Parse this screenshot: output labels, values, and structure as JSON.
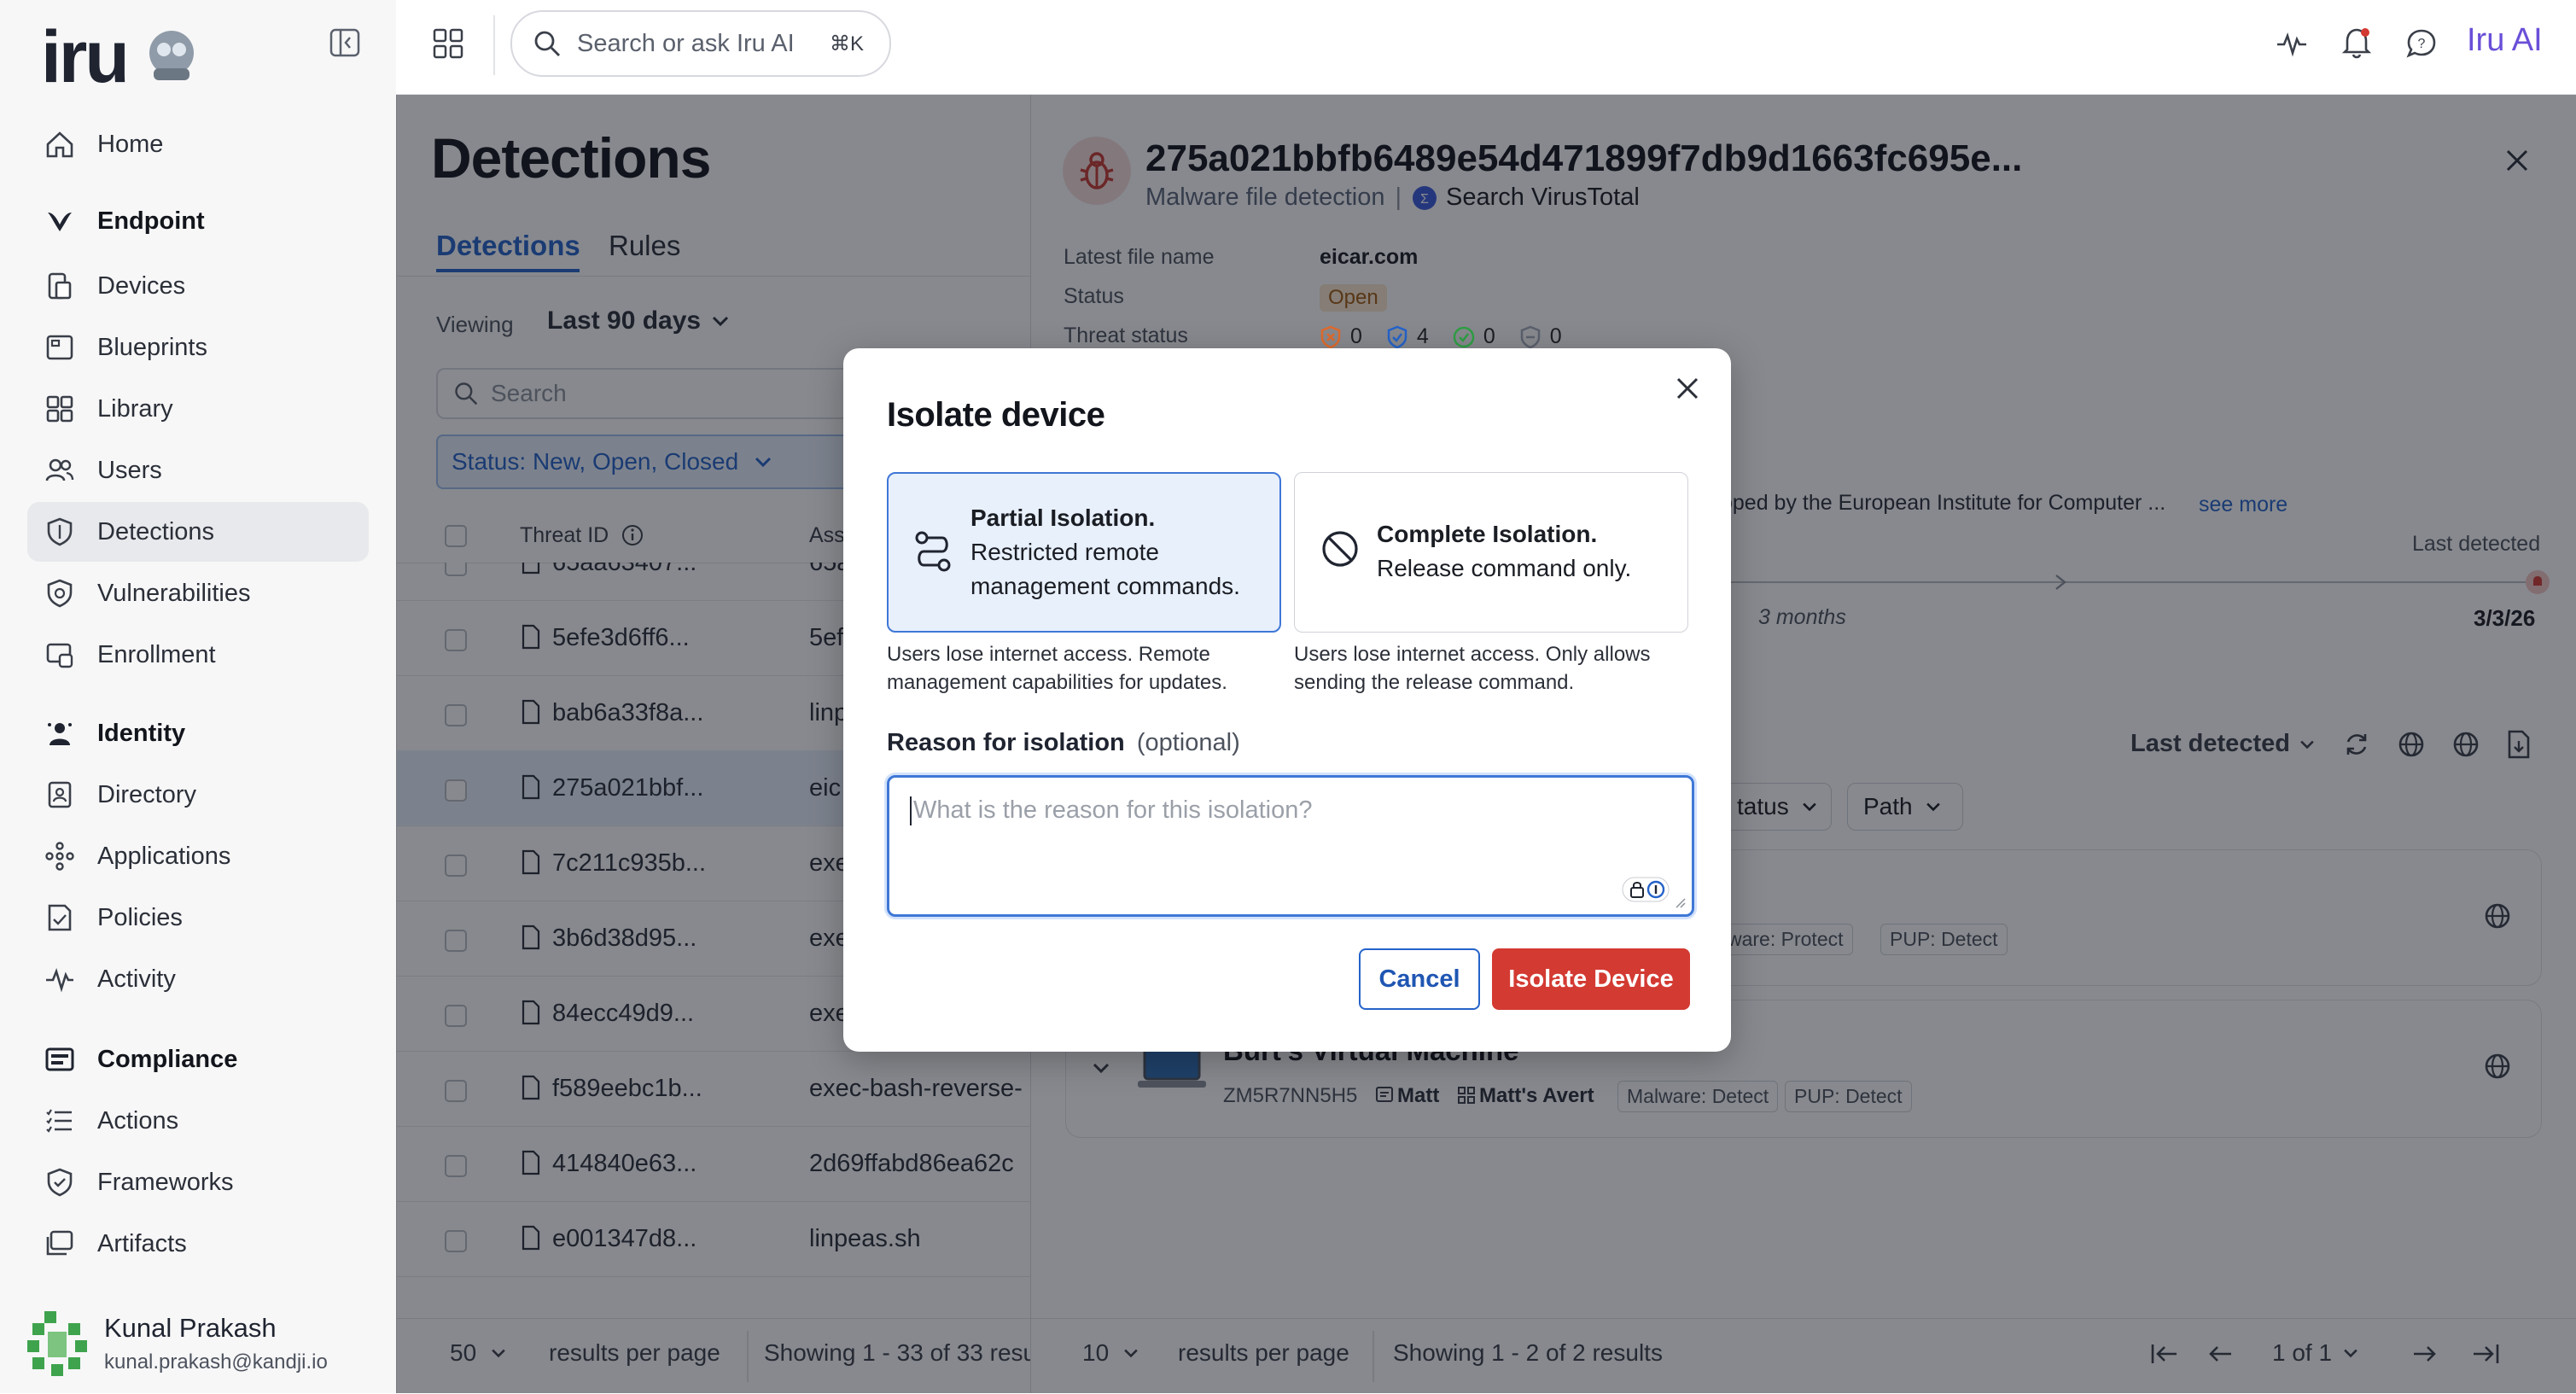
{
  "app": {
    "logo_text": "iru",
    "ai_label": "Iru AI"
  },
  "search": {
    "placeholder": "Search or ask Iru AI",
    "shortcut": "⌘K"
  },
  "sidebar": {
    "items": [
      {
        "label": "Home",
        "icon": "home-icon"
      },
      {
        "label": "Endpoint",
        "icon": "endpoint-icon",
        "section": true
      },
      {
        "label": "Devices",
        "icon": "devices-icon"
      },
      {
        "label": "Blueprints",
        "icon": "blueprints-icon"
      },
      {
        "label": "Library",
        "icon": "library-icon"
      },
      {
        "label": "Users",
        "icon": "users-icon"
      },
      {
        "label": "Detections",
        "icon": "detections-icon",
        "active": true
      },
      {
        "label": "Vulnerabilities",
        "icon": "vulnerabilities-icon"
      },
      {
        "label": "Enrollment",
        "icon": "enrollment-icon"
      },
      {
        "label": "Identity",
        "icon": "identity-icon",
        "section": true
      },
      {
        "label": "Directory",
        "icon": "directory-icon"
      },
      {
        "label": "Applications",
        "icon": "applications-icon"
      },
      {
        "label": "Policies",
        "icon": "policies-icon"
      },
      {
        "label": "Activity",
        "icon": "activity-icon"
      },
      {
        "label": "Compliance",
        "icon": "compliance-icon",
        "section": true
      },
      {
        "label": "Actions",
        "icon": "actions-icon"
      },
      {
        "label": "Frameworks",
        "icon": "frameworks-icon"
      },
      {
        "label": "Artifacts",
        "icon": "artifacts-icon"
      }
    ],
    "user": {
      "name": "Kunal Prakash",
      "email": "kunal.prakash@kandji.io"
    }
  },
  "detections": {
    "title": "Detections",
    "tabs": [
      "Detections",
      "Rules"
    ],
    "viewing_label": "Viewing",
    "viewing_value": "Last 90 days",
    "search_placeholder": "Search",
    "status_filter": "Status: New, Open, Closed",
    "columns": {
      "threat_id": "Threat ID",
      "asset": "Ass"
    },
    "rows": [
      {
        "id": "65aa63407...",
        "asset": "65a"
      },
      {
        "id": "5efe3d6ff6...",
        "asset": "5ef"
      },
      {
        "id": "bab6a33f8a...",
        "asset": "linp"
      },
      {
        "id": "275a021bbf...",
        "asset": "eic",
        "selected": true
      },
      {
        "id": "7c211c935b...",
        "asset": "exe"
      },
      {
        "id": "3b6d38d95...",
        "asset": "exe"
      },
      {
        "id": "84ecc49d9...",
        "asset": "exe"
      },
      {
        "id": "f589eebc1b...",
        "asset": "exec-bash-reverse-"
      },
      {
        "id": "414840e63...",
        "asset": "2d69ffabd86ea62c"
      },
      {
        "id": "e001347d8...",
        "asset": "linpeas.sh"
      }
    ],
    "footer": {
      "per_page": "50",
      "per_page_label": "results per page",
      "showing": "Showing 1 - 33 of 33 resu"
    }
  },
  "detail": {
    "title": "275a021bbfb6489e54d471899f7db9d1663fc695e...",
    "subtitle": "Malware file detection",
    "virustotal": "Search VirusTotal",
    "fields": {
      "latest_file_name_label": "Latest file name",
      "latest_file_name": "eicar.com",
      "status_label": "Status",
      "status": "Open",
      "threat_status_label": "Threat status",
      "threat_counts": [
        "0",
        "4",
        "0",
        "0"
      ]
    },
    "description_tail": "oped by the European Institute for Computer ...",
    "see_more": "see more",
    "timeline": {
      "last_detected_label": "Last detected",
      "duration": "3 months",
      "date": "3/3/26"
    },
    "sort": "Last detected",
    "filters": [
      "tatus",
      "Path"
    ],
    "device1": {
      "tags": [
        "ware: Protect",
        "PUP: Detect"
      ]
    },
    "device2": {
      "name": "Burt's Virtual Machine",
      "serial": "ZM5R7NN5H5",
      "user": "Matt",
      "blueprint": "Matt's Avert",
      "tags": [
        "Malware: Detect",
        "PUP: Detect"
      ]
    },
    "footer": {
      "per_page": "10",
      "per_page_label": "results per page",
      "showing": "Showing 1 - 2 of 2 results",
      "pagination": "1 of 1"
    }
  },
  "modal": {
    "title": "Isolate device",
    "options": [
      {
        "title": "Partial Isolation.",
        "body": "Restricted remote management commands.",
        "description": "Users lose internet access. Remote management capabilities for updates.",
        "selected": true
      },
      {
        "title": "Complete Isolation.",
        "body": "Release command only.",
        "description": "Users lose internet access. Only allows sending the release command.",
        "selected": false
      }
    ],
    "reason_label": "Reason for isolation",
    "reason_optional": "(optional)",
    "reason_placeholder": "What is the reason for this isolation?",
    "cancel": "Cancel",
    "confirm": "Isolate Device"
  },
  "colors": {
    "accent": "#2563c9",
    "danger": "#d33a32",
    "ai_purple": "#6a4fd8"
  }
}
